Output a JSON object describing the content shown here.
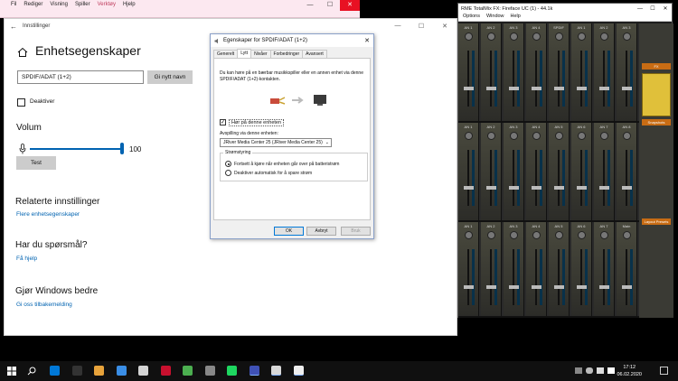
{
  "strip_window": {
    "menu": [
      "Fil",
      "Rediger",
      "Visning",
      "Spiller",
      "Verktøy",
      "Hjelp"
    ],
    "highlight_index": 4,
    "ctrl_min": "—",
    "ctrl_max": "☐",
    "ctrl_close": "✕"
  },
  "settings": {
    "window_title": "Innstillinger",
    "back": "←",
    "ctrl_min": "—",
    "ctrl_max": "☐",
    "ctrl_close": "✕",
    "page_title": "Enhetsegenskaper",
    "device_name": "SPDIF/ADAT (1+2)",
    "rename_label": "Gi nytt navn",
    "disable_label": "Deaktiver",
    "volume_title": "Volum",
    "volume_value": "100",
    "volume_level": 1.0,
    "test_label": "Test",
    "related_title": "Relaterte innstillinger",
    "related_link": "Flere enhetsegenskaper",
    "question_title": "Har du spørsmål?",
    "question_link": "Få hjelp",
    "better_title": "Gjør Windows bedre",
    "better_link": "Gi oss tilbakemelding"
  },
  "dialog": {
    "title": "Egenskaper for SPDIF/ADAT (1+2)",
    "close": "✕",
    "tabs": [
      "Generelt",
      "Lytt",
      "Nivåer",
      "Forbedringer",
      "Avansert"
    ],
    "active_tab": 1,
    "description": "Du kan høre på en bærbar musikkspiller eller en annen enhet via denne SPDIF/ADAT (1+2)-kontakten.",
    "listen_label": "Hør på denne enheten",
    "listen_check": "✓",
    "playback_label": "Avspilling via denne enheten:",
    "playback_value": "JRiver Media Center 25 (JRiver Media Center 25)",
    "playback_arrow": "⌄",
    "power_group": "Strømstyring",
    "radio_continue": "Fortsett å kjøre når enheten går over på batteristrøm",
    "radio_disable": "Deaktiver automatisk for å spare strøm",
    "ok": "OK",
    "cancel": "Avbryt",
    "apply": "Bruk"
  },
  "rme": {
    "title": "RME TotalMix FX: Fireface UC (1) - 44.1k",
    "ctrl_min": "—",
    "ctrl_max": "☐",
    "ctrl_close": "✕",
    "menu": [
      "Options",
      "Window",
      "Help"
    ],
    "row1_labels": [
      "AN 1",
      "AN 2",
      "AN 3",
      "AN 4",
      "SPDIF",
      "AN 1",
      "AN 2",
      "AN 3"
    ],
    "row2_labels": [
      "AN 1",
      "AN 2",
      "AN 3",
      "AN 4",
      "AN 5",
      "AN 6",
      "AN 7",
      "AN 8"
    ],
    "row3_labels": [
      "AN 1",
      "AN 2",
      "AN 3",
      "AN 4",
      "AN 5",
      "AN 6",
      "AN 7",
      "Main"
    ],
    "side_hdr1": "FX",
    "side_hdr2": "Snapshots",
    "side_hdr3": "Layout Presets"
  },
  "taskbar": {
    "time": "17:12",
    "date": "06.02.2020",
    "icon_colors": [
      "#0078d7",
      "#333",
      "#e8a33b",
      "#3a8ee6",
      "#d4d4d4",
      "#c8102e",
      "#4caf50",
      "#888",
      "#1ed760",
      "#3f51b5",
      "#d8d8d8",
      "#eee"
    ]
  }
}
